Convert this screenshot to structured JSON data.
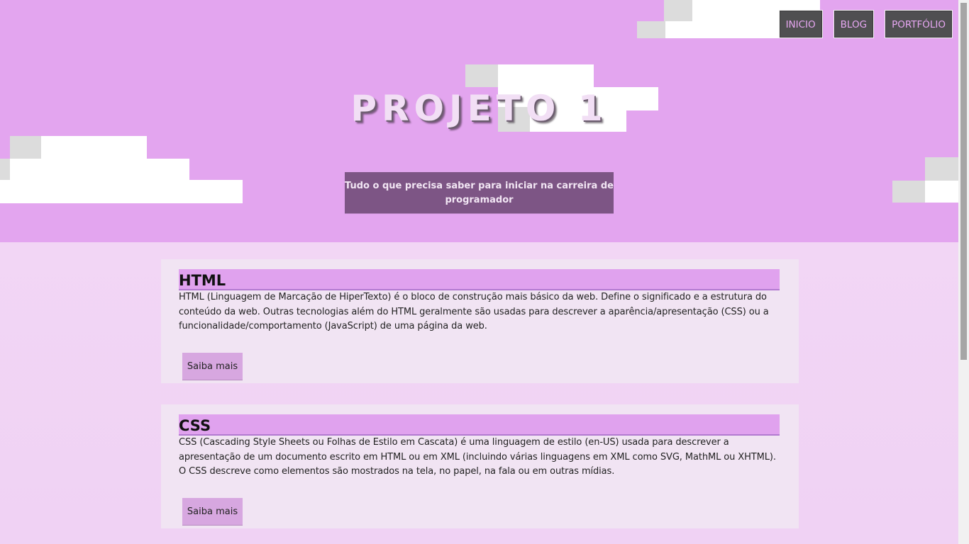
{
  "nav": {
    "items": [
      {
        "label": "INICIO"
      },
      {
        "label": "BLOG"
      },
      {
        "label": "PORTFÓLIO"
      }
    ]
  },
  "hero": {
    "title": "PROJETO 1",
    "subtitle": "Tudo o que precisa saber para iniciar na carreira de programador",
    "background_color": "#e3a5ef"
  },
  "cards": [
    {
      "title": "HTML",
      "text": "HTML (Linguagem de Marcação de HiperTexto) é o bloco de construção mais básico da web. Define o significado e a estrutura do conteúdo da web. Outras tecnologias além do HTML geralmente são usadas para descrever a aparência/apresentação (CSS) ou a funcionalidade/comportamento (JavaScript) de uma página da web.",
      "button": "Saiba mais"
    },
    {
      "title": "CSS",
      "text": "CSS (Cascading Style Sheets ou Folhas de Estilo em Cascata) é uma linguagem de estilo (en-US) usada para descrever a apresentação de um documento escrito em HTML ou em XML (incluindo várias linguagens em XML como SVG, MathML ou XHTML). O CSS descreve como elementos são mostrados na tela, no papel, na fala ou em outras mídias.",
      "button": "Saiba mais"
    }
  ],
  "colors": {
    "accent": "#e0a2ee",
    "nav_bg": "#4f4f51",
    "subtitle_bg": "#7d5585"
  }
}
